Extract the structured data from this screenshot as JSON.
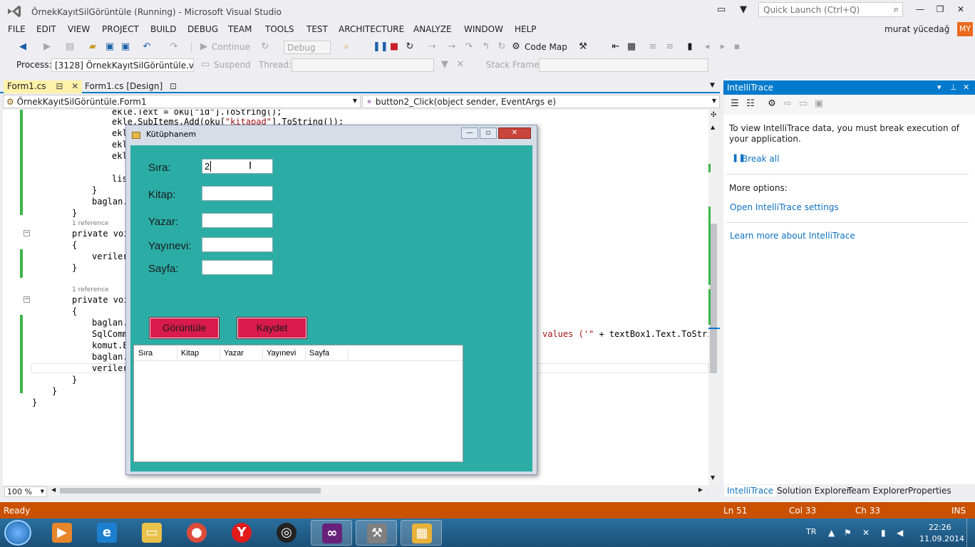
{
  "window": {
    "title": "ÖrnekKayıtSilGörüntüle (Running) - Microsoft Visual Studio",
    "quick_launch_placeholder": "Quick Launch (Ctrl+Q)",
    "user_name": "murat yücedağ",
    "user_initials": "MY"
  },
  "menu": [
    "FILE",
    "EDIT",
    "VIEW",
    "PROJECT",
    "BUILD",
    "DEBUG",
    "TEAM",
    "TOOLS",
    "TEST",
    "ARCHITECTURE",
    "ANALYZE",
    "WINDOW",
    "HELP"
  ],
  "toolbar": {
    "continue_label": "Continue",
    "config_value": "Debug",
    "code_map_label": "Code Map",
    "process_label": "Process:",
    "process_value": "[3128] ÖrnekKayıtSilGörüntüle.vshost.exe",
    "suspend_label": "Suspend",
    "thread_label": "Thread:",
    "stack_frame_label": "Stack Frame:"
  },
  "doc_tabs": [
    {
      "label": "Form1.cs",
      "active": true
    },
    {
      "label": "Form1.cs [Design]",
      "active": false
    }
  ],
  "nav": {
    "class_value": "ÖrnekKayıtSilGörüntüle.Form1",
    "member_value": "button2_Click(object sender, EventArgs e)"
  },
  "code": {
    "line1": "ekle.Text = oku[\"id\"].ToString();",
    "line2_a": "ekle.SubItems.Add(oku[",
    "line2_str": "\"kitapad\"",
    "line2_b": "].ToString());",
    "line3": "ekl",
    "line4": "ekl",
    "line5": "ekl",
    "line6": "lis",
    "line7": "}",
    "line8": "baglan.",
    "line9": "}",
    "ref1": "1 reference",
    "line10_kw": "private voi",
    "line11": "{",
    "line12": "veriler",
    "line13": "}",
    "ref2": "1 reference",
    "line14_kw": "private voi",
    "line15": "{",
    "line16": "baglan.",
    "line17_ty": "SqlComm",
    "line17_tail_str": "values ('\"",
    "line17_tail": " + textBox1.Text.ToStri",
    "line18": "komut.E",
    "line19": "baglan.",
    "line20": "veriler",
    "line21": "}",
    "line22": "}",
    "line23": "}"
  },
  "zoom": "100 %",
  "app": {
    "title": "Kütüphanem",
    "labels": {
      "sira": "Sıra:",
      "kitap": "Kitap:",
      "yazar": "Yazar:",
      "yayinevi": "Yayınevi:",
      "sayfa": "Sayfa:"
    },
    "values": {
      "sira": "2",
      "kitap": "",
      "yazar": "",
      "yayinevi": "",
      "sayfa": ""
    },
    "buttons": {
      "goruntule": "Görüntüle",
      "kaydet": "Kaydet"
    },
    "list_columns": [
      "Sıra",
      "Kitap",
      "Yazar",
      "Yayınevi",
      "Sayfa"
    ]
  },
  "intellitrace": {
    "title": "IntelliTrace",
    "message": "To view IntelliTrace data, you must break execution of your application.",
    "break_all": "Break all",
    "more_options": "More options:",
    "open_settings": "Open IntelliTrace settings",
    "learn_more": "Learn more about IntelliTrace",
    "tabs": [
      "IntelliTrace",
      "Solution Explorer",
      "Team Explorer",
      "Properties"
    ]
  },
  "status": {
    "state": "Ready",
    "line": "Ln 51",
    "col": "Col 33",
    "ch": "Ch 33",
    "mode": "INS"
  },
  "taskbar": {
    "language": "TR",
    "time": "22:26",
    "date": "11.09.2014"
  },
  "colors": {
    "accent": "#007acc",
    "status_bar": "#ca5100",
    "form_bg": "#2bada5",
    "form_button": "#d81b4c"
  }
}
